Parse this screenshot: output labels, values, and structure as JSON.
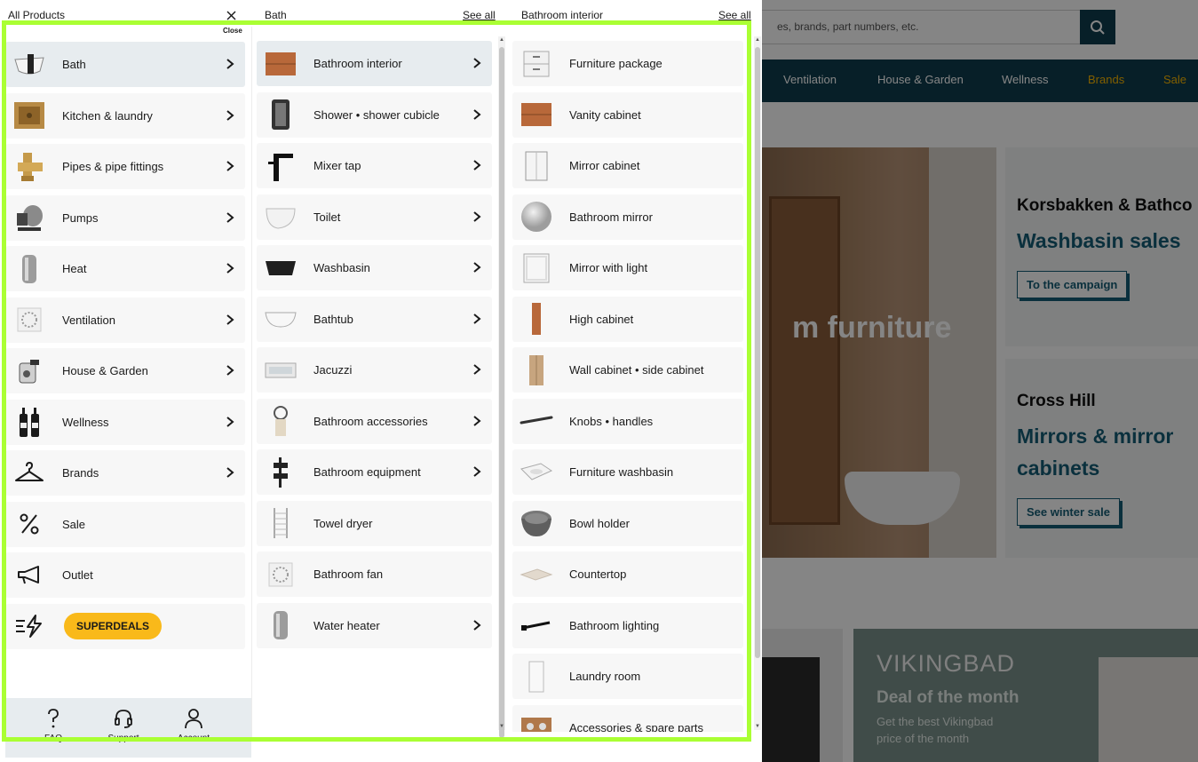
{
  "background": {
    "search_placeholder": "es, brands, part numbers, etc.",
    "nav": [
      {
        "label": "Ventilation",
        "highlight": false
      },
      {
        "label": "House & Garden",
        "highlight": false
      },
      {
        "label": "Wellness",
        "highlight": false
      },
      {
        "label": "Brands",
        "highlight": true
      },
      {
        "label": "Sale",
        "highlight": true
      }
    ],
    "hero_title": "m furniture",
    "cards": [
      {
        "brand": "Korsbakken & Bathco",
        "title": "Washbasin sales",
        "button": "To the campaign"
      },
      {
        "brand": "Cross Hill",
        "title": "Mirrors & mirror cabinets",
        "button": "See winter sale"
      }
    ],
    "promo": {
      "logo": "VIKINGBAD",
      "title": "Deal of the month",
      "desc_line1": "Get the best Vikingbad",
      "desc_line2": "price of the month"
    }
  },
  "menu": {
    "col1_header": "All Products",
    "col2_header": "Bath",
    "col2_see_all": "See all",
    "col3_header": "Bathroom interior",
    "col3_see_all": "See all",
    "close_label": "Close",
    "categories": [
      {
        "label": "Bath",
        "icon": "bath-icon",
        "active": true,
        "chevron": true
      },
      {
        "label": "Kitchen & laundry",
        "icon": "kitchen-sink-icon",
        "active": false,
        "chevron": true
      },
      {
        "label": "Pipes & pipe fittings",
        "icon": "pipe-fitting-icon",
        "active": false,
        "chevron": true
      },
      {
        "label": "Pumps",
        "icon": "pump-icon",
        "active": false,
        "chevron": true
      },
      {
        "label": "Heat",
        "icon": "water-heater-icon",
        "active": false,
        "chevron": true
      },
      {
        "label": "Ventilation",
        "icon": "vent-icon",
        "active": false,
        "chevron": true
      },
      {
        "label": "House & Garden",
        "icon": "garden-tap-icon",
        "active": false,
        "chevron": true
      },
      {
        "label": "Wellness",
        "icon": "wellness-bottles-icon",
        "active": false,
        "chevron": true
      },
      {
        "label": "Brands",
        "icon": "hanger-icon",
        "active": false,
        "chevron": true
      },
      {
        "label": "Sale",
        "icon": "percent-icon",
        "active": false,
        "chevron": false
      },
      {
        "label": "Outlet",
        "icon": "megaphone-icon",
        "active": false,
        "chevron": false
      }
    ],
    "superdeals_label": "SUPERDEALS",
    "subcategories": [
      {
        "label": "Bathroom interior",
        "icon": "vanity-drawers-icon",
        "active": true,
        "chevron": true
      },
      {
        "label": "Shower • shower cubicle",
        "icon": "shower-cubicle-icon",
        "active": false,
        "chevron": true
      },
      {
        "label": "Mixer tap",
        "icon": "mixer-tap-icon",
        "active": false,
        "chevron": true
      },
      {
        "label": "Toilet",
        "icon": "toilet-icon",
        "active": false,
        "chevron": true
      },
      {
        "label": "Washbasin",
        "icon": "washbasin-icon",
        "active": false,
        "chevron": true
      },
      {
        "label": "Bathtub",
        "icon": "bathtub-icon",
        "active": false,
        "chevron": true
      },
      {
        "label": "Jacuzzi",
        "icon": "jacuzzi-icon",
        "active": false,
        "chevron": true
      },
      {
        "label": "Bathroom accessories",
        "icon": "towel-ring-icon",
        "active": false,
        "chevron": true
      },
      {
        "label": "Bathroom equipment",
        "icon": "shower-caddy-icon",
        "active": false,
        "chevron": true
      },
      {
        "label": "Towel dryer",
        "icon": "towel-dryer-icon",
        "active": false,
        "chevron": false
      },
      {
        "label": "Bathroom fan",
        "icon": "bathroom-fan-icon",
        "active": false,
        "chevron": false
      },
      {
        "label": "Water heater",
        "icon": "boiler-icon",
        "active": false,
        "chevron": true
      }
    ],
    "items": [
      {
        "label": "Furniture package",
        "icon": "furniture-package-icon"
      },
      {
        "label": "Vanity cabinet",
        "icon": "vanity-cabinet-icon"
      },
      {
        "label": "Mirror cabinet",
        "icon": "mirror-cabinet-icon"
      },
      {
        "label": "Bathroom mirror",
        "icon": "round-mirror-icon"
      },
      {
        "label": "Mirror with light",
        "icon": "lit-mirror-icon"
      },
      {
        "label": "High cabinet",
        "icon": "high-cabinet-icon"
      },
      {
        "label": "Wall cabinet • side cabinet",
        "icon": "wall-cabinet-icon"
      },
      {
        "label": "Knobs • handles",
        "icon": "handle-icon"
      },
      {
        "label": "Furniture washbasin",
        "icon": "furniture-washbasin-icon"
      },
      {
        "label": "Bowl holder",
        "icon": "bowl-icon"
      },
      {
        "label": "Countertop",
        "icon": "countertop-icon"
      },
      {
        "label": "Bathroom lighting",
        "icon": "wall-light-icon"
      },
      {
        "label": "Laundry room",
        "icon": "laundry-cabinet-icon"
      },
      {
        "label": "Accessories & spare parts",
        "icon": "spare-parts-icon"
      }
    ],
    "footer": [
      {
        "label": "FAQ",
        "icon": "question-icon"
      },
      {
        "label": "Support",
        "icon": "headset-icon"
      },
      {
        "label": "Account",
        "icon": "user-icon"
      }
    ]
  }
}
